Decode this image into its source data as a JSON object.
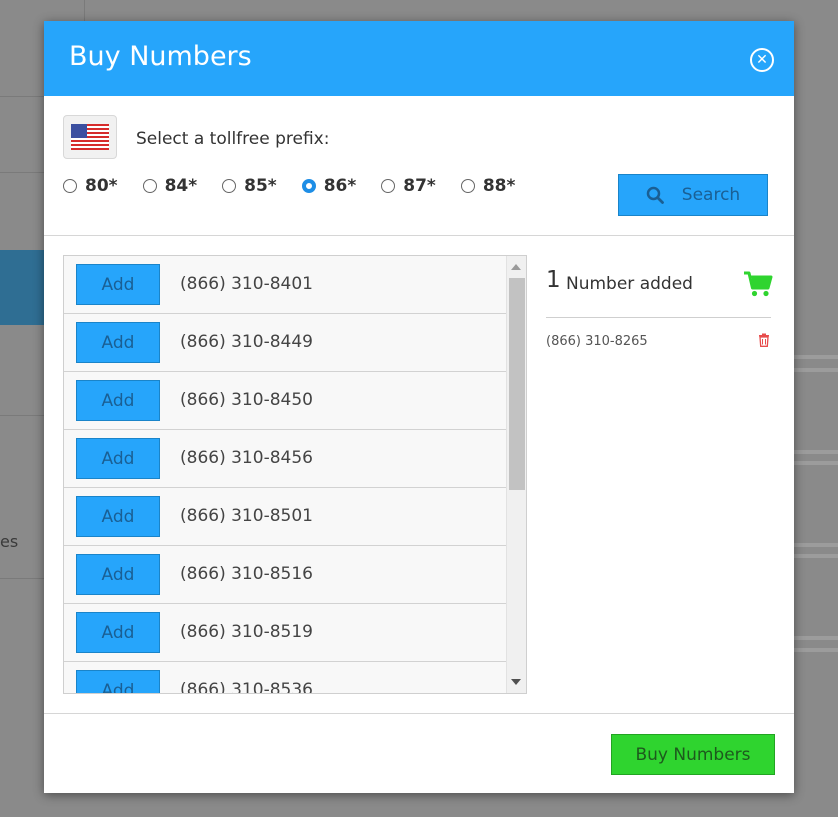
{
  "background": {
    "partial_text": "es"
  },
  "modal": {
    "title": "Buy Numbers",
    "close_icon": "close-circle-icon"
  },
  "prefix": {
    "flag_icon": "us-flag-icon",
    "label": "Select a tollfree prefix:",
    "options": [
      "80*",
      "84*",
      "85*",
      "86*",
      "87*",
      "88*"
    ],
    "selected": "86*"
  },
  "search": {
    "label": "Search",
    "icon": "search-icon"
  },
  "results": {
    "add_label": "Add",
    "numbers": [
      "(866) 310-8401",
      "(866) 310-8449",
      "(866) 310-8450",
      "(866) 310-8456",
      "(866) 310-8501",
      "(866) 310-8516",
      "(866) 310-8519",
      "(866) 310-8536"
    ]
  },
  "cart": {
    "count": "1",
    "label": "Number added",
    "icon": "shopping-cart-icon",
    "items": [
      "(866) 310-8265"
    ]
  },
  "footer": {
    "buy_label": "Buy Numbers"
  },
  "colors": {
    "header": "#26a5fb",
    "accent_blue": "#26a5fb",
    "buy_green": "#2fd42f",
    "cart_green": "#2fd42f",
    "trash_red": "#e84c4c"
  }
}
